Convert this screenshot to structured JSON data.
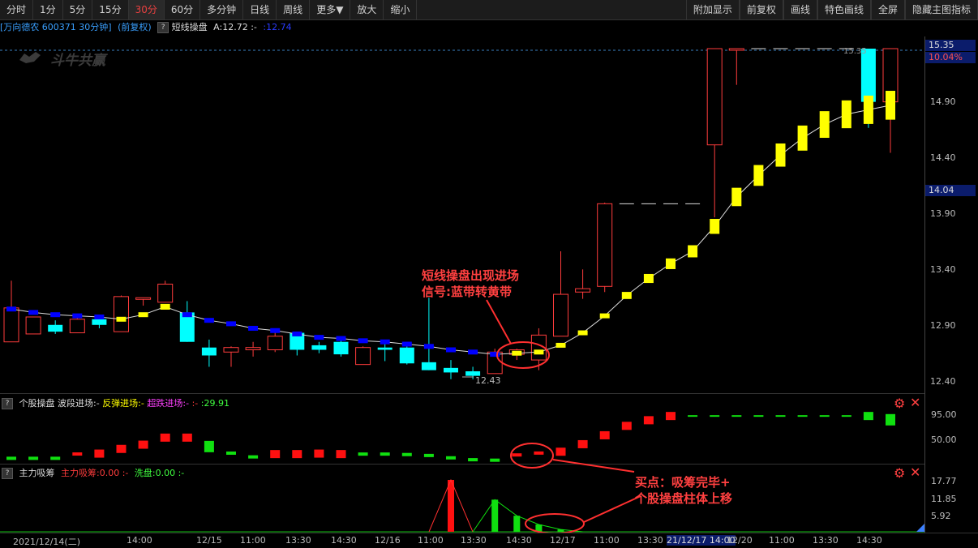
{
  "toolbar": {
    "left_tabs": [
      "分时",
      "1分",
      "5分",
      "15分",
      "30分",
      "60分",
      "多分钟",
      "日线",
      "周线",
      "更多▼",
      "放大",
      "缩小"
    ],
    "active_tab": "30分",
    "right_buttons": [
      "附加显示",
      "前复权",
      "画线",
      "特色画线",
      "全屏",
      "隐藏主图指标"
    ]
  },
  "main_header": {
    "stock": "[万向德农 600371 30分钟]",
    "adjust": "(前复权)",
    "qmark": "?",
    "indicator": "短线操盘",
    "a_value": "A:12.72",
    "dash": ":-",
    "b_value": ":12.74"
  },
  "watermark": "斗牛共赢",
  "price_axis": {
    "ticks": [
      "14.90",
      "14.40",
      "13.90",
      "13.40",
      "12.90",
      "12.40"
    ],
    "top_price": "15.35",
    "top_pct": "10.04%",
    "current_price": "14.04",
    "low_label": "12.43",
    "high_label": "15.35"
  },
  "panel2": {
    "qmark": "?",
    "title": "个股操盘",
    "l1": "波段进场:-",
    "l2": "反弹进场:-",
    "l3": "超跌进场:-",
    "l4": ":-",
    "value": ":29.91",
    "ticks": [
      "95.00",
      "50.00"
    ]
  },
  "panel3": {
    "qmark": "?",
    "title": "主力吸筹",
    "l1": "主力吸筹:0.00",
    "l2": ":-",
    "l3": "洗盘:0.00",
    "l4": ":-",
    "ticks": [
      "17.77",
      "11.85",
      "5.92"
    ]
  },
  "annotations": {
    "a1_line1": "短线操盘出现进场",
    "a1_line2": "信号:蓝带转黄带",
    "a2_line1": "买点：吸筹完毕+",
    "a2_line2": "个股操盘柱体上移"
  },
  "dates": [
    "2021/12/14(二)",
    "14:00",
    "12/15",
    "11:00",
    "13:30",
    "14:30",
    "12/16",
    "11:00",
    "13:30",
    "14:30",
    "12/17",
    "11:00",
    "13:30",
    "21/12/17 14:00",
    "12/20",
    "11:00",
    "13:30",
    "14:30"
  ],
  "colors": {
    "up": "#ff3c3c",
    "down": "#00ffff",
    "ribbon_blue": "#0000ff",
    "ribbon_yellow": "#ffff00",
    "accent": "#e84040"
  },
  "chart_data": {
    "type": "candlestick",
    "ylim": [
      12.3,
      15.4
    ],
    "candles": [
      {
        "o": 12.76,
        "h": 13.3,
        "c": 13.06,
        "l": 12.79,
        "r": 13.05,
        "rc": "blue"
      },
      {
        "o": 12.83,
        "h": 12.96,
        "c": 12.98,
        "l": 12.83,
        "r": 13.02,
        "rc": "blue"
      },
      {
        "o": 12.91,
        "h": 12.95,
        "c": 12.85,
        "l": 12.83,
        "r": 13.0,
        "rc": "blue"
      },
      {
        "o": 12.84,
        "h": 13.0,
        "c": 12.96,
        "l": 12.84,
        "r": 12.99,
        "rc": "blue"
      },
      {
        "o": 12.96,
        "h": 12.99,
        "c": 12.91,
        "l": 12.88,
        "r": 12.98,
        "rc": "blue"
      },
      {
        "o": 12.85,
        "h": 13.17,
        "c": 13.16,
        "l": 12.85,
        "r": 12.96,
        "rc": "yellow"
      },
      {
        "o": 13.15,
        "h": 13.15,
        "c": 13.15,
        "l": 13.08,
        "r": 13.0,
        "rc": "yellow"
      },
      {
        "o": 13.11,
        "h": 13.3,
        "c": 13.27,
        "l": 13.11,
        "r": 13.07,
        "rc": "yellow"
      },
      {
        "o": 13.02,
        "h": 13.12,
        "c": 12.76,
        "l": 12.76,
        "r": 13.0,
        "rc": "blue"
      },
      {
        "o": 12.71,
        "h": 12.78,
        "c": 12.64,
        "l": 12.54,
        "r": 12.95,
        "rc": "blue"
      },
      {
        "o": 12.67,
        "h": 12.72,
        "c": 12.71,
        "l": 12.54,
        "r": 12.92,
        "rc": "blue"
      },
      {
        "o": 12.69,
        "h": 12.76,
        "c": 12.71,
        "l": 12.63,
        "r": 12.88,
        "rc": "blue"
      },
      {
        "o": 12.69,
        "h": 12.87,
        "c": 12.81,
        "l": 12.67,
        "r": 12.86,
        "rc": "blue"
      },
      {
        "o": 12.84,
        "h": 12.85,
        "c": 12.69,
        "l": 12.64,
        "r": 12.83,
        "rc": "blue"
      },
      {
        "o": 12.73,
        "h": 12.76,
        "c": 12.69,
        "l": 12.66,
        "r": 12.8,
        "rc": "blue"
      },
      {
        "o": 12.76,
        "h": 12.77,
        "c": 12.65,
        "l": 12.63,
        "r": 12.79,
        "rc": "blue"
      },
      {
        "o": 12.56,
        "h": 12.72,
        "c": 12.71,
        "l": 12.56,
        "r": 12.77,
        "rc": "blue"
      },
      {
        "o": 12.71,
        "h": 12.75,
        "c": 12.69,
        "l": 12.59,
        "r": 12.76,
        "rc": "blue"
      },
      {
        "o": 12.71,
        "h": 12.75,
        "c": 12.57,
        "l": 12.56,
        "r": 12.74,
        "rc": "blue"
      },
      {
        "o": 12.58,
        "h": 13.15,
        "c": 12.51,
        "l": 12.51,
        "r": 12.72,
        "rc": "blue"
      },
      {
        "o": 12.53,
        "h": 12.6,
        "c": 12.49,
        "l": 12.43,
        "r": 12.69,
        "rc": "blue"
      },
      {
        "o": 12.5,
        "h": 12.54,
        "c": 12.46,
        "l": 12.43,
        "r": 12.67,
        "rc": "blue"
      },
      {
        "o": 12.48,
        "h": 12.7,
        "c": 12.67,
        "l": 12.48,
        "r": 12.65,
        "rc": "blue"
      },
      {
        "o": 12.65,
        "h": 12.7,
        "c": 12.69,
        "l": 12.6,
        "r": 12.66,
        "rc": "yellow"
      },
      {
        "o": 12.6,
        "h": 12.88,
        "c": 12.82,
        "l": 12.51,
        "r": 12.67,
        "rc": "yellow"
      },
      {
        "o": 12.81,
        "h": 13.56,
        "c": 13.18,
        "l": 12.81,
        "r": 12.73,
        "rc": "yellow"
      },
      {
        "o": 13.2,
        "h": 13.4,
        "c": 13.23,
        "l": 13.14,
        "r": 12.84,
        "rc": "yellow"
      },
      {
        "o": 13.25,
        "h": 13.99,
        "c": 13.98,
        "l": 13.2,
        "r": 12.99,
        "rc": "yellow"
      },
      {
        "o": 13.98,
        "h": 13.98,
        "c": 13.98,
        "l": 13.98,
        "r": 13.17,
        "rc": "yellow"
      },
      {
        "o": 13.98,
        "h": 13.98,
        "c": 13.98,
        "l": 13.98,
        "r": 13.32,
        "rc": "yellow"
      },
      {
        "o": 13.98,
        "h": 13.98,
        "c": 13.98,
        "l": 13.98,
        "r": 13.45,
        "rc": "yellow"
      },
      {
        "o": 13.98,
        "h": 13.98,
        "c": 13.98,
        "l": 13.98,
        "r": 13.56,
        "rc": "yellow"
      },
      {
        "o": 14.5,
        "h": 15.35,
        "c": 15.35,
        "l": 13.86,
        "r": 13.78,
        "rc": "yellow"
      },
      {
        "o": 15.35,
        "h": 15.35,
        "c": 15.35,
        "l": 15.03,
        "r": 14.04,
        "rc": "yellow"
      },
      {
        "o": 15.35,
        "h": 15.35,
        "c": 15.35,
        "l": 15.35,
        "r": 14.23,
        "rc": "yellow"
      },
      {
        "o": 15.35,
        "h": 15.35,
        "c": 15.35,
        "l": 15.35,
        "r": 14.41,
        "rc": "yellow"
      },
      {
        "o": 15.35,
        "h": 15.35,
        "c": 15.35,
        "l": 15.35,
        "r": 14.56,
        "rc": "yellow"
      },
      {
        "o": 15.35,
        "h": 15.35,
        "c": 15.35,
        "l": 15.35,
        "r": 14.68,
        "rc": "yellow"
      },
      {
        "o": 15.35,
        "h": 15.35,
        "c": 15.35,
        "l": 15.35,
        "r": 14.77,
        "rc": "yellow"
      },
      {
        "o": 15.35,
        "h": 15.35,
        "c": 14.88,
        "l": 14.65,
        "r": 14.81,
        "rc": "yellow"
      },
      {
        "o": 14.88,
        "h": 15.35,
        "c": 15.35,
        "l": 14.43,
        "r": 14.85,
        "rc": "yellow"
      }
    ],
    "panel2_bars": [
      {
        "v": 8,
        "c": "g"
      },
      {
        "v": 8,
        "c": "g"
      },
      {
        "v": 8,
        "c": "g"
      },
      {
        "v": 12,
        "c": "r"
      },
      {
        "v": 18,
        "c": "r"
      },
      {
        "v": 28,
        "c": "r"
      },
      {
        "v": 37,
        "c": "r"
      },
      {
        "v": 52,
        "c": "r"
      },
      {
        "v": 52,
        "c": "r"
      },
      {
        "v": 33,
        "c": "g"
      },
      {
        "v": 19,
        "c": "g"
      },
      {
        "v": 11,
        "c": "g"
      },
      {
        "v": 17,
        "c": "r"
      },
      {
        "v": 17,
        "c": "r"
      },
      {
        "v": 18,
        "c": "r"
      },
      {
        "v": 17,
        "c": "r"
      },
      {
        "v": 17,
        "c": "g"
      },
      {
        "v": 17,
        "c": "g"
      },
      {
        "v": 16,
        "c": "g"
      },
      {
        "v": 14,
        "c": "g"
      },
      {
        "v": 9,
        "c": "g"
      },
      {
        "v": 5,
        "c": "g"
      },
      {
        "v": 4,
        "c": "g"
      },
      {
        "v": 10,
        "c": "r"
      },
      {
        "v": 14,
        "c": "r"
      },
      {
        "v": 22,
        "c": "r"
      },
      {
        "v": 38,
        "c": "r"
      },
      {
        "v": 57,
        "c": "r"
      },
      {
        "v": 77,
        "c": "r"
      },
      {
        "v": 89,
        "c": "r"
      },
      {
        "v": 98,
        "c": "r"
      },
      {
        "v": 98,
        "c": "g"
      },
      {
        "v": 98,
        "c": "g"
      },
      {
        "v": 98,
        "c": "g"
      },
      {
        "v": 98,
        "c": "g"
      },
      {
        "v": 98,
        "c": "g"
      },
      {
        "v": 98,
        "c": "g"
      },
      {
        "v": 98,
        "c": "g"
      },
      {
        "v": 98,
        "c": "g"
      },
      {
        "v": 98,
        "c": "g"
      },
      {
        "v": 90,
        "c": "g"
      }
    ],
    "panel3_red": [
      0,
      0,
      0,
      0,
      0,
      0,
      0,
      0,
      0,
      0,
      0,
      0,
      0,
      0,
      0,
      0,
      0,
      0,
      0,
      0,
      17.77,
      0,
      0,
      0,
      0,
      0,
      0,
      0,
      0,
      0,
      0,
      0,
      0,
      0,
      0,
      0,
      0,
      0,
      0,
      0,
      0
    ],
    "panel3_green": [
      0,
      0,
      0,
      0,
      0,
      0,
      0,
      0,
      0,
      0,
      0,
      0,
      0,
      0,
      0,
      0,
      0,
      0,
      0,
      0,
      0,
      0,
      11.0,
      5.5,
      2.5,
      0.8,
      0,
      0,
      0,
      0,
      0,
      0,
      0,
      0,
      0,
      0,
      0,
      0,
      0,
      0,
      0
    ]
  }
}
